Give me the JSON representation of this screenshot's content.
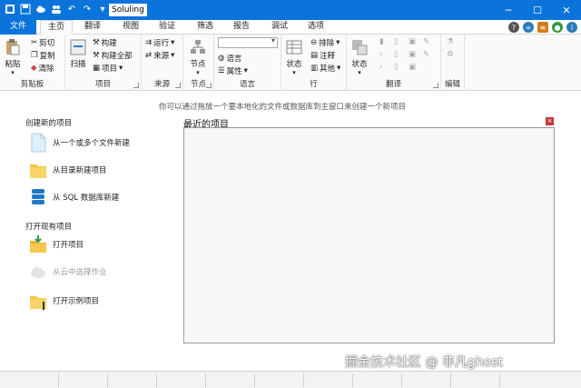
{
  "titlebar": {
    "doc_title": "Soluling",
    "colors": {
      "accent": "#0a74da"
    }
  },
  "menu": {
    "tabs": [
      "文件",
      "主页",
      "翻译",
      "视图",
      "验证",
      "筛选",
      "报告",
      "调试",
      "选项"
    ]
  },
  "ribbon": {
    "clipboard": {
      "label": "剪贴板",
      "paste": "粘贴",
      "cut": "剪切",
      "copy": "复制",
      "clear": "清除"
    },
    "project": {
      "label": "项目",
      "scan": "扫描",
      "build": "构建",
      "build_all": "构建全部",
      "items": "项目"
    },
    "source": {
      "label": "来源",
      "run": "运行",
      "source": "来源"
    },
    "node": {
      "label": "节点",
      "node": "节点"
    },
    "language": {
      "label": "语言",
      "language": "语言",
      "properties": "属性"
    },
    "row": {
      "label": "行",
      "status": "状态",
      "sort": "排除",
      "comment": "注释",
      "other": "其他"
    },
    "translate": {
      "label": "翻译",
      "status": "状态"
    },
    "edit": {
      "label": "编辑"
    }
  },
  "main": {
    "hint": "你可以通过拖放一个要本地化的文件或数据库到主窗口来创建一个新项目",
    "create_title": "创建新的项目",
    "create_items": [
      "从一个或多个文件新建",
      "从目录新建项目",
      "从 SQL 数据库新建"
    ],
    "open_title": "打开现有项目",
    "open_items": [
      "打开项目",
      "从云中选择作业",
      "打开示例项目"
    ],
    "recent_title": "最近的项目"
  },
  "watermark": "掘金技术社区 @ 非凡ghost"
}
